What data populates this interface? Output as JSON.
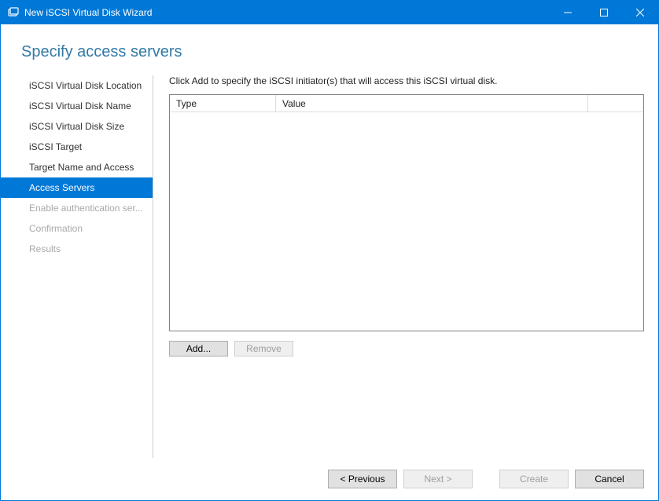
{
  "window": {
    "title": "New iSCSI Virtual Disk Wizard"
  },
  "page": {
    "title": "Specify access servers",
    "instruction": "Click Add to specify the iSCSI initiator(s) that will access this iSCSI virtual disk."
  },
  "sidebar": {
    "items": [
      {
        "label": "iSCSI Virtual Disk Location",
        "state": "normal"
      },
      {
        "label": "iSCSI Virtual Disk Name",
        "state": "normal"
      },
      {
        "label": "iSCSI Virtual Disk Size",
        "state": "normal"
      },
      {
        "label": "iSCSI Target",
        "state": "normal"
      },
      {
        "label": "Target Name and Access",
        "state": "normal"
      },
      {
        "label": "Access Servers",
        "state": "active"
      },
      {
        "label": "Enable authentication ser...",
        "state": "disabled"
      },
      {
        "label": "Confirmation",
        "state": "disabled"
      },
      {
        "label": "Results",
        "state": "disabled"
      }
    ]
  },
  "table": {
    "columns": {
      "type": "Type",
      "value": "Value"
    },
    "rows": []
  },
  "buttons": {
    "add": "Add...",
    "remove": "Remove",
    "previous": "< Previous",
    "next": "Next >",
    "create": "Create",
    "cancel": "Cancel"
  }
}
